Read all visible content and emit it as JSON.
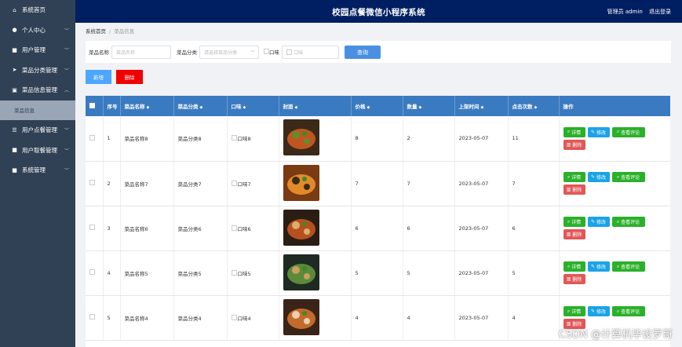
{
  "header": {
    "title": "校园点餐微信小程序系统",
    "user": "管理员 admin",
    "logout": "退出登录"
  },
  "sidebar": {
    "items": [
      {
        "label": "系统首页",
        "icon": "home-icon",
        "expandable": false
      },
      {
        "label": "个人中心",
        "icon": "user-icon",
        "expandable": true
      },
      {
        "label": "用户管理",
        "icon": "grid-icon",
        "expandable": true
      },
      {
        "label": "菜品分类管理",
        "icon": "send-icon",
        "expandable": true
      },
      {
        "label": "菜品信息管理",
        "icon": "doc-icon",
        "expandable": true,
        "open": true,
        "sub": "菜品信息"
      },
      {
        "label": "用户点餐管理",
        "icon": "sliders-icon",
        "expandable": true
      },
      {
        "label": "用户取餐管理",
        "icon": "grid-icon",
        "expandable": true
      },
      {
        "label": "系统管理",
        "icon": "grid-icon",
        "expandable": true
      }
    ]
  },
  "breadcrumb": {
    "home": "系统首页",
    "current": "菜品信息"
  },
  "filter": {
    "name_label": "菜品名称",
    "name_placeholder": "菜品名称",
    "cat_label": "菜品分类",
    "cat_placeholder": "请选择菜品分类",
    "taste_label": "口味",
    "taste_placeholder": "口味",
    "search": "查询"
  },
  "actions": {
    "add": "新增",
    "delete": "删除"
  },
  "table": {
    "columns": [
      "序号",
      "菜品名称",
      "菜品分类",
      "口味",
      "封面",
      "价格",
      "数量",
      "上架时间",
      "点击次数",
      "操作"
    ],
    "op_labels": {
      "detail": "详情",
      "edit": "修改",
      "review": "查看评论",
      "remove": "删除"
    },
    "rows": [
      {
        "no": "1",
        "name": "菜品名称8",
        "cat": "菜品分类8",
        "taste": "口味8",
        "price": "8",
        "qty": "2",
        "date": "2023-05-07",
        "clicks": "11",
        "img": "dish-a"
      },
      {
        "no": "2",
        "name": "菜品名称7",
        "cat": "菜品分类7",
        "taste": "口味7",
        "price": "7",
        "qty": "7",
        "date": "2023-05-07",
        "clicks": "7",
        "img": "dish-b"
      },
      {
        "no": "3",
        "name": "菜品名称6",
        "cat": "菜品分类6",
        "taste": "口味6",
        "price": "6",
        "qty": "6",
        "date": "2023-05-07",
        "clicks": "6",
        "img": "dish-c"
      },
      {
        "no": "4",
        "name": "菜品名称5",
        "cat": "菜品分类5",
        "taste": "口味5",
        "price": "5",
        "qty": "5",
        "date": "2023-05-07",
        "clicks": "5",
        "img": "dish-d"
      },
      {
        "no": "5",
        "name": "菜品名称4",
        "cat": "菜品分类4",
        "taste": "口味4",
        "price": "4",
        "qty": "4",
        "date": "2023-05-07",
        "clicks": "4",
        "img": "dish-e"
      }
    ]
  },
  "watermark": "CSDN @计算机毕设罗哥"
}
